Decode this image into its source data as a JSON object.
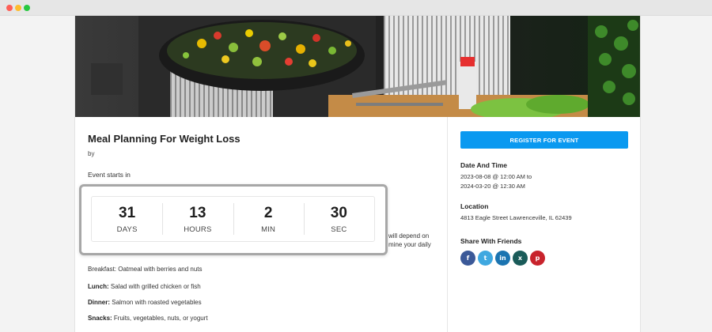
{
  "event": {
    "title": "Meal Planning For Weight Loss",
    "by": "by",
    "starts_label": "Event starts in"
  },
  "countdown": [
    {
      "value": "31",
      "label": "DAYS"
    },
    {
      "value": "13",
      "label": "HOURS"
    },
    {
      "value": "2",
      "label": "MIN"
    },
    {
      "value": "30",
      "label": "SEC"
    }
  ],
  "body_text": {
    "partial_right_1": "will depend on",
    "partial_right_2": "mine your daily",
    "breakfast_partial": "Breakfast: Oatmeal with berries and nuts",
    "lunch_label": "Lunch:",
    "lunch_text": "Salad with grilled chicken or fish",
    "dinner_label": "Dinner:",
    "dinner_text": "Salmon with roasted vegetables",
    "snacks_label": "Snacks:",
    "snacks_text": "Fruits, vegetables, nuts, or yogurt"
  },
  "sidebar": {
    "register_label": "REGISTER FOR EVENT",
    "date_heading": "Date And Time",
    "date_line1": "2023-08-08 @ 12:00 AM to",
    "date_line2": "2024-03-20 @ 12:30 AM",
    "location_heading": "Location",
    "location_text": "4813 Eagle Street Lawrenceville, IL 62439",
    "share_heading": "Share With Friends",
    "share_icons": [
      {
        "name": "facebook-icon",
        "glyph": "f",
        "color": "#3b5998"
      },
      {
        "name": "twitter-icon",
        "glyph": "t",
        "color": "#3fa8e0"
      },
      {
        "name": "linkedin-icon",
        "glyph": "in",
        "color": "#1b74b1"
      },
      {
        "name": "xing-icon",
        "glyph": "x",
        "color": "#1a5b59"
      },
      {
        "name": "pinterest-icon",
        "glyph": "p",
        "color": "#c8232c"
      }
    ]
  },
  "colors": {
    "accent": "#0a99f0",
    "window_dots": [
      "#fe5f57",
      "#febc2e",
      "#28c840"
    ]
  }
}
